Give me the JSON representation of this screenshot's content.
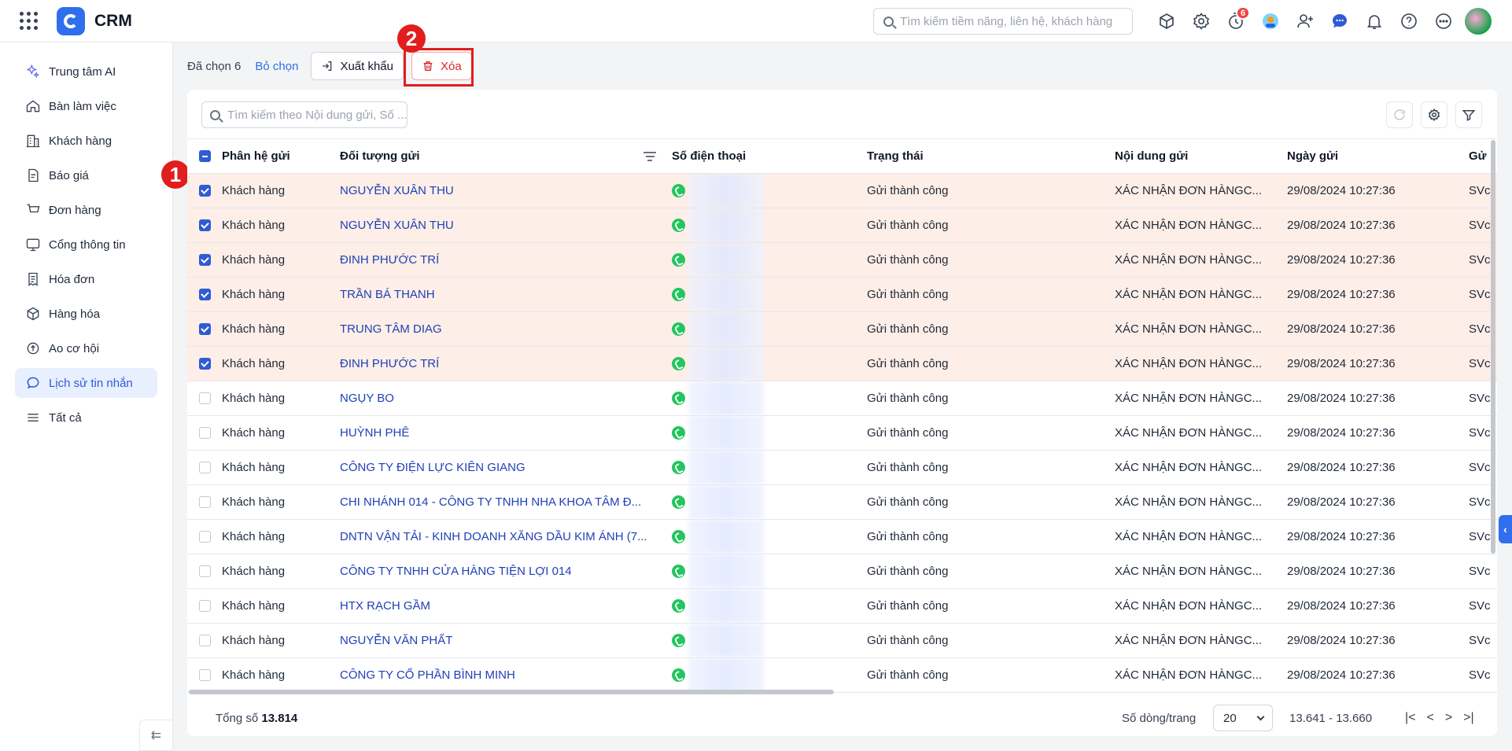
{
  "app": {
    "title": "CRM"
  },
  "header": {
    "search_placeholder": "Tìm kiếm tiềm năng, liên hệ, khách hàng",
    "notification_badge": "6"
  },
  "sidebar": {
    "items": [
      {
        "label": "Trung tâm AI",
        "icon": "sparkles-icon"
      },
      {
        "label": "Bàn làm việc",
        "icon": "home-icon"
      },
      {
        "label": "Khách hàng",
        "icon": "building-icon"
      },
      {
        "label": "Báo giá",
        "icon": "quote-doc-icon"
      },
      {
        "label": "Đơn hàng",
        "icon": "cart-icon"
      },
      {
        "label": "Cổng thông tin",
        "icon": "portal-icon"
      },
      {
        "label": "Hóa đơn",
        "icon": "invoice-icon"
      },
      {
        "label": "Hàng hóa",
        "icon": "box-icon"
      },
      {
        "label": "Ao cơ hội",
        "icon": "opportunity-icon"
      },
      {
        "label": "Lịch sử tin nhắn",
        "icon": "chat-icon"
      },
      {
        "label": "Tất cả",
        "icon": "menu-icon"
      }
    ],
    "active_index": 9
  },
  "selection": {
    "count_label": "Đã chọn 6",
    "clear_label": "Bỏ chọn",
    "export_label": "Xuất khẩu",
    "delete_label": "Xóa"
  },
  "annotations": {
    "one": "1",
    "two": "2"
  },
  "table": {
    "search_placeholder": "Tìm kiếm theo Nội dung gửi, Số ...",
    "columns": [
      "Phân hệ gửi",
      "Đối tượng gửi",
      "Số điện thoại",
      "Trạng thái",
      "Nội dung gửi",
      "Ngày gửi",
      "Gử"
    ],
    "rows": [
      {
        "selected": true,
        "module": "Khách hàng",
        "target": "NGUYỄN XUÂN THU",
        "status": "Gửi thành công",
        "content": "XÁC NHẬN ĐƠN HÀNGC...",
        "date": "29/08/2024 10:27:36",
        "sender": "SVc"
      },
      {
        "selected": true,
        "module": "Khách hàng",
        "target": "NGUYỄN XUÂN THU",
        "status": "Gửi thành công",
        "content": "XÁC NHẬN ĐƠN HÀNGC...",
        "date": "29/08/2024 10:27:36",
        "sender": "SVc"
      },
      {
        "selected": true,
        "module": "Khách hàng",
        "target": "ĐINH PHƯỚC TRÍ",
        "status": "Gửi thành công",
        "content": "XÁC NHẬN ĐƠN HÀNGC...",
        "date": "29/08/2024 10:27:36",
        "sender": "SVc"
      },
      {
        "selected": true,
        "module": "Khách hàng",
        "target": "TRẦN BÁ THANH",
        "status": "Gửi thành công",
        "content": "XÁC NHẬN ĐƠN HÀNGC...",
        "date": "29/08/2024 10:27:36",
        "sender": "SVc"
      },
      {
        "selected": true,
        "module": "Khách hàng",
        "target": "TRUNG TÂM DIAG",
        "status": "Gửi thành công",
        "content": "XÁC NHẬN ĐƠN HÀNGC...",
        "date": "29/08/2024 10:27:36",
        "sender": "SVc"
      },
      {
        "selected": true,
        "module": "Khách hàng",
        "target": "ĐINH PHƯỚC TRÍ",
        "status": "Gửi thành công",
        "content": "XÁC NHẬN ĐƠN HÀNGC...",
        "date": "29/08/2024 10:27:36",
        "sender": "SVc"
      },
      {
        "selected": false,
        "module": "Khách hàng",
        "target": "NGỤY BO",
        "status": "Gửi thành công",
        "content": "XÁC NHẬN ĐƠN HÀNGC...",
        "date": "29/08/2024 10:27:36",
        "sender": "SVc"
      },
      {
        "selected": false,
        "module": "Khách hàng",
        "target": "HUỲNH PHÊ",
        "status": "Gửi thành công",
        "content": "XÁC NHẬN ĐƠN HÀNGC...",
        "date": "29/08/2024 10:27:36",
        "sender": "SVc"
      },
      {
        "selected": false,
        "module": "Khách hàng",
        "target": "CÔNG TY ĐIỆN LỰC KIÊN GIANG",
        "status": "Gửi thành công",
        "content": "XÁC NHẬN ĐƠN HÀNGC...",
        "date": "29/08/2024 10:27:36",
        "sender": "SVc"
      },
      {
        "selected": false,
        "module": "Khách hàng",
        "target": "CHI NHÁNH 014 - CÔNG TY TNHH NHA KHOA TÂM Đ...",
        "status": "Gửi thành công",
        "content": "XÁC NHẬN ĐƠN HÀNGC...",
        "date": "29/08/2024 10:27:36",
        "sender": "SVc"
      },
      {
        "selected": false,
        "module": "Khách hàng",
        "target": "DNTN VẬN TẢI - KINH DOANH XĂNG DẦU KIM ÁNH (7...",
        "status": "Gửi thành công",
        "content": "XÁC NHẬN ĐƠN HÀNGC...",
        "date": "29/08/2024 10:27:36",
        "sender": "SVc"
      },
      {
        "selected": false,
        "module": "Khách hàng",
        "target": "CÔNG TY TNHH CỬA HÀNG TIỆN LỢI 014",
        "status": "Gửi thành công",
        "content": "XÁC NHẬN ĐƠN HÀNGC...",
        "date": "29/08/2024 10:27:36",
        "sender": "SVc"
      },
      {
        "selected": false,
        "module": "Khách hàng",
        "target": "HTX RẠCH GẦM",
        "status": "Gửi thành công",
        "content": "XÁC NHẬN ĐƠN HÀNGC...",
        "date": "29/08/2024 10:27:36",
        "sender": "SVc"
      },
      {
        "selected": false,
        "module": "Khách hàng",
        "target": "NGUYỄN VĂN PHẤT",
        "status": "Gửi thành công",
        "content": "XÁC NHẬN ĐƠN HÀNGC...",
        "date": "29/08/2024 10:27:36",
        "sender": "SVc"
      },
      {
        "selected": false,
        "module": "Khách hàng",
        "target": "CÔNG TY CỔ PHẦN BÌNH MINH",
        "status": "Gửi thành công",
        "content": "XÁC NHẬN ĐƠN HÀNGC...",
        "date": "29/08/2024 10:27:36",
        "sender": "SVc"
      }
    ]
  },
  "footer": {
    "total_label": "Tổng số",
    "total_value": "13.814",
    "rows_per_page_label": "Số dòng/trang",
    "rows_per_page_value": "20",
    "range": "13.641 - 13.660"
  },
  "colors": {
    "accent": "#2f6fed",
    "selected_row": "#fdeee7",
    "annotation": "#e11d1d",
    "link": "#2040b8"
  }
}
